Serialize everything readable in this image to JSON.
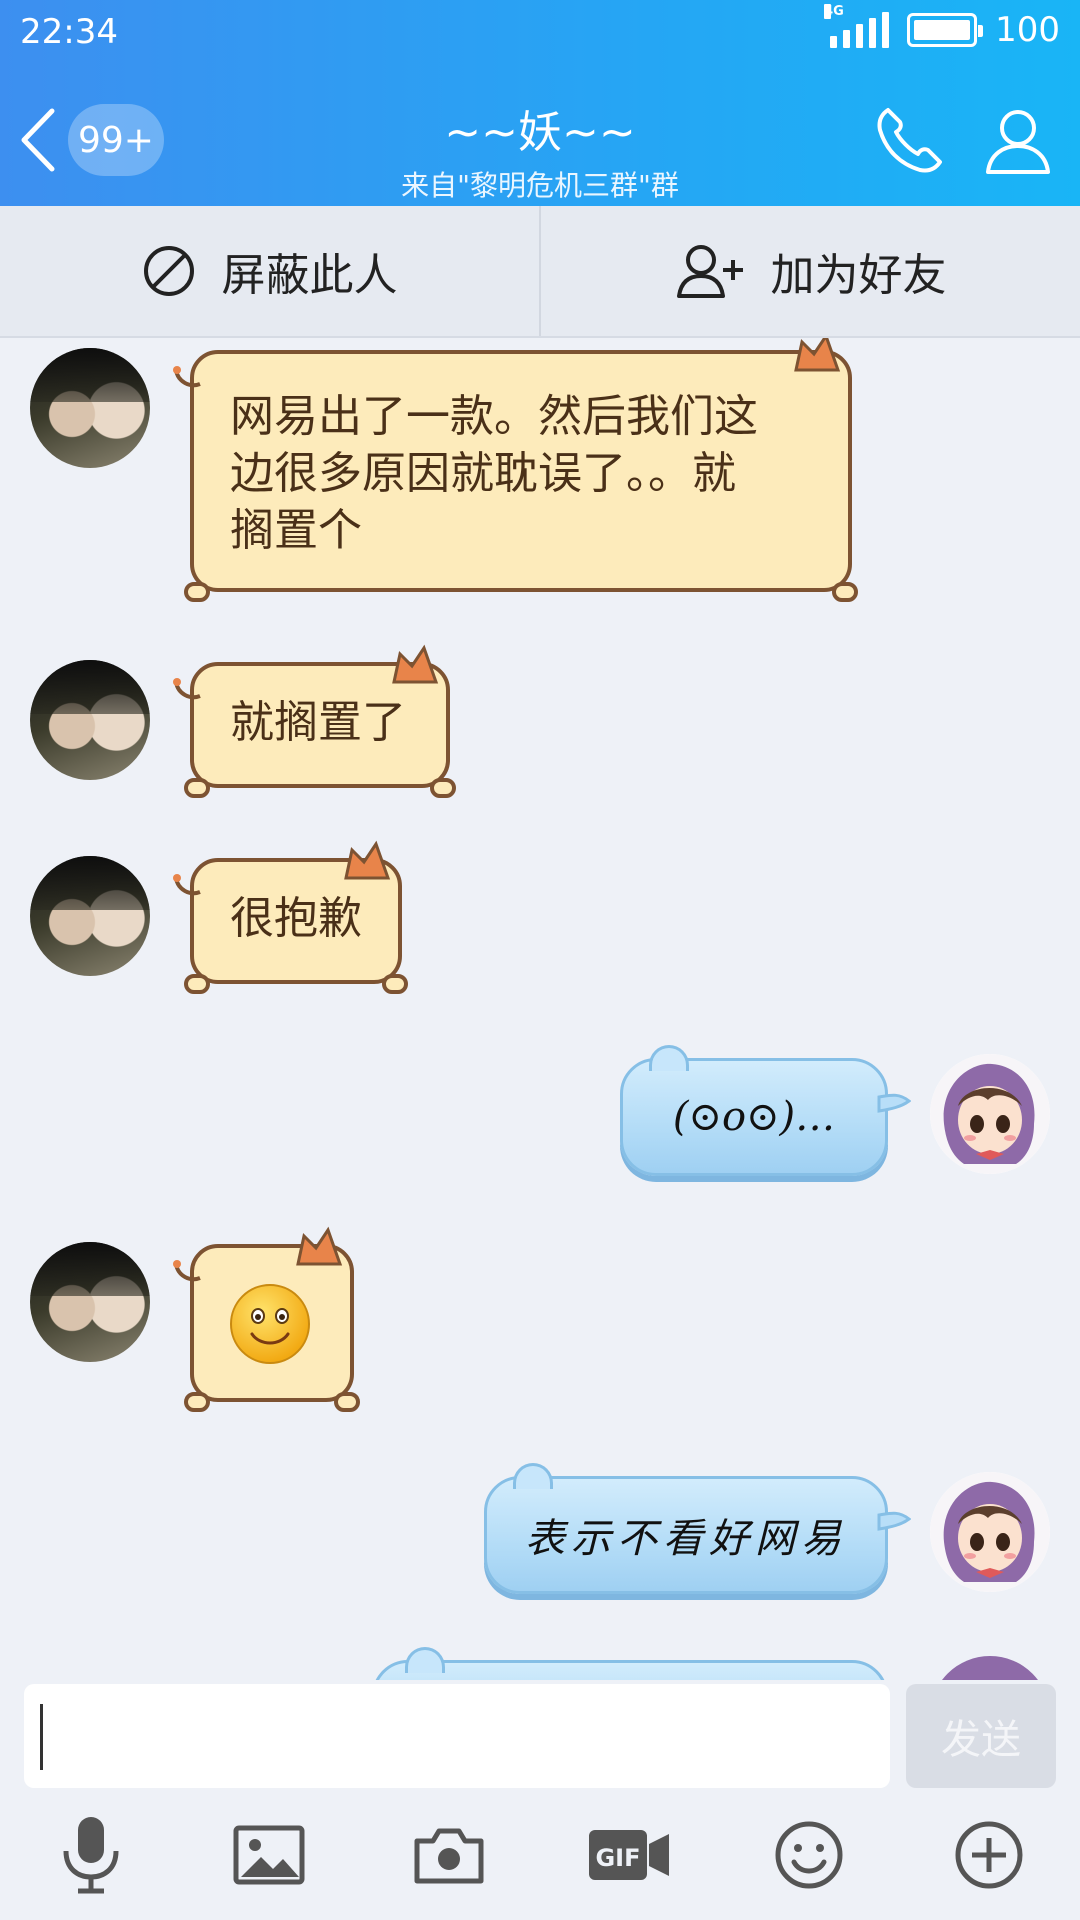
{
  "status_bar": {
    "time": "22:34",
    "network": "4G",
    "battery": "100"
  },
  "header": {
    "unread_badge": "99+",
    "title": "~~妖~~",
    "subtitle": "来自\"黎明危机三群\"群"
  },
  "actions": {
    "block_label": "屏蔽此人",
    "add_friend_label": "加为好友"
  },
  "messages": [
    {
      "side": "left",
      "text_lines": [
        "网易出了一款。然后我们这",
        "边很多原因就耽误了。。就",
        "搁置个"
      ]
    },
    {
      "side": "left",
      "text": "就搁置了"
    },
    {
      "side": "left",
      "text": "很抱歉"
    },
    {
      "side": "right",
      "text": "(⊙o⊙)…"
    },
    {
      "side": "left",
      "emoji": "smile-emoji"
    },
    {
      "side": "right",
      "text": "表示不看好网易"
    }
  ],
  "input": {
    "placeholder": "",
    "send_label": "发送"
  },
  "toolbar": {
    "icons": [
      "microphone-icon",
      "image-icon",
      "camera-icon",
      "gif-icon",
      "emoji-icon",
      "plus-icon"
    ]
  },
  "colors": {
    "header_gradient_start": "#3d8ff0",
    "header_gradient_end": "#19b5f6",
    "cat_bubble_fill": "#fdebbb",
    "cat_bubble_border": "#7d5332",
    "blue_bubble_fill": "#b3dcf7"
  }
}
